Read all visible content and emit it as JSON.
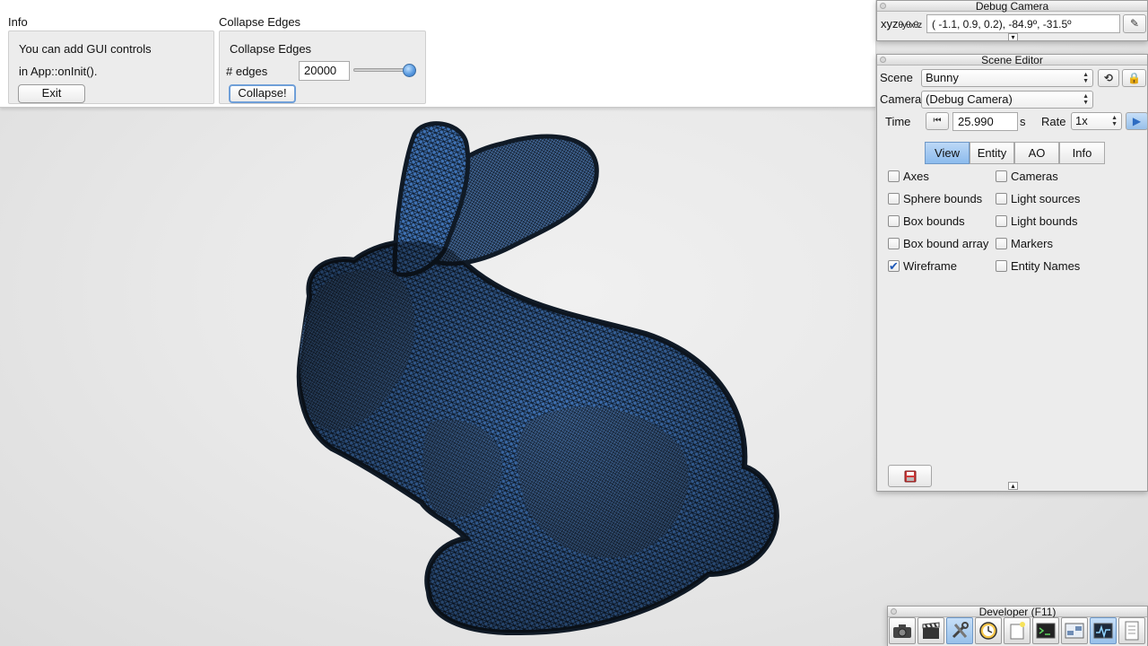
{
  "info_pane": {
    "caption": "Info",
    "line1": "You can add GUI controls",
    "line2": "in App::onInit().",
    "exit_label": "Exit"
  },
  "collapse_pane": {
    "caption": "Collapse Edges",
    "header": "Collapse Edges",
    "edges_label": "# edges",
    "edges_value": "20000",
    "slider_fraction": 1.0,
    "collapse_label": "Collapse!"
  },
  "debug_camera": {
    "title": "Debug Camera",
    "xyz_label": "xyz",
    "xyz_subscript": "θyθxθz",
    "coords_value": "( -1.1,    0.9,    0.2), -84.9º, -31.5º",
    "expand_arrow": "▾"
  },
  "scene_editor": {
    "title": "Scene Editor",
    "scene_label": "Scene",
    "scene_value": "Bunny",
    "camera_label": "Camera",
    "camera_value": "(Debug Camera)",
    "time_label": "Time",
    "time_value": "25.990",
    "time_unit": "s",
    "rate_label": "Rate",
    "rate_value": "1x",
    "tabs": [
      "View",
      "Entity",
      "AO",
      "Info"
    ],
    "active_tab": "View",
    "checkboxes": [
      {
        "label": "Axes",
        "checked": false
      },
      {
        "label": "Sphere bounds",
        "checked": false
      },
      {
        "label": "Box bounds",
        "checked": false
      },
      {
        "label": "Box bound array",
        "checked": false
      },
      {
        "label": "Wireframe",
        "checked": true
      },
      {
        "label": "Cameras",
        "checked": false
      },
      {
        "label": "Light sources",
        "checked": false
      },
      {
        "label": "Light bounds",
        "checked": false
      },
      {
        "label": "Markers",
        "checked": false
      },
      {
        "label": "Entity Names",
        "checked": false
      }
    ],
    "collapse_arrow": "▴"
  },
  "developer": {
    "title": "Developer (F11)",
    "icons": [
      "camera-icon",
      "clapperboard-icon",
      "tools-icon",
      "clock-icon",
      "new-window-icon",
      "terminal-icon",
      "scene-graph-icon",
      "profiler-icon",
      "log-icon"
    ]
  },
  "colors": {
    "mesh_fill": "#4a7fc4",
    "mesh_edge": "#0b1420",
    "accent_blue": "#8cbbed"
  }
}
